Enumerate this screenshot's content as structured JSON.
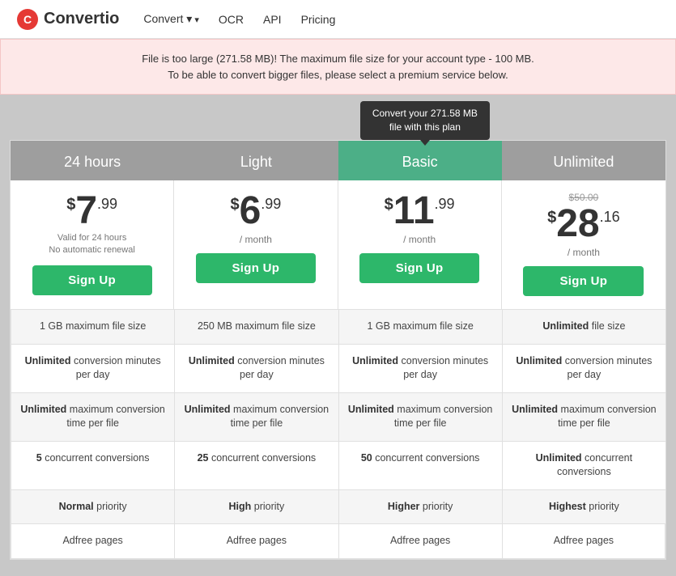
{
  "nav": {
    "logo_text": "Convertio",
    "links": [
      {
        "label": "Convert",
        "has_arrow": true
      },
      {
        "label": "OCR",
        "has_arrow": false
      },
      {
        "label": "API",
        "has_arrow": false
      },
      {
        "label": "Pricing",
        "has_arrow": false
      }
    ]
  },
  "alert": {
    "line1": "File is too large (271.58 MB)! The maximum file size for your account type - 100 MB.",
    "line2": "To be able to convert bigger files, please select a premium service below."
  },
  "tooltip": {
    "text": "Convert your 271.58 MB file with this plan"
  },
  "plans": [
    {
      "id": "24hours",
      "name": "24 hours",
      "header_class": "gray",
      "price_dollar": "$",
      "price_int": "7",
      "price_decimal": ".99",
      "price_period": "",
      "price_note": "Valid for 24 hours\nNo automatic renewal",
      "price_original": null,
      "signup_label": "Sign Up"
    },
    {
      "id": "light",
      "name": "Light",
      "header_class": "gray",
      "price_dollar": "$",
      "price_int": "6",
      "price_decimal": ".99",
      "price_period": "/ month",
      "price_note": null,
      "price_original": null,
      "signup_label": "Sign Up"
    },
    {
      "id": "basic",
      "name": "Basic",
      "header_class": "green-dark",
      "price_dollar": "$",
      "price_int": "11",
      "price_decimal": ".99",
      "price_period": "/ month",
      "price_note": null,
      "price_original": null,
      "signup_label": "Sign Up"
    },
    {
      "id": "unlimited",
      "name": "Unlimited",
      "header_class": "gray",
      "price_dollar": "$",
      "price_int": "28",
      "price_decimal": ".16",
      "price_period": "/ month",
      "price_note": null,
      "price_original": "$50.00",
      "signup_label": "Sign Up"
    }
  ],
  "features": [
    {
      "id": "file-size",
      "cells": [
        "1 GB maximum file size",
        "250 MB maximum file size",
        "1 GB maximum file size",
        "Unlimited file size"
      ],
      "bold_word": [
        "",
        "",
        "",
        "Unlimited"
      ]
    },
    {
      "id": "conv-minutes",
      "cells": [
        "Unlimited conversion minutes per day",
        "Unlimited conversion minutes per day",
        "Unlimited conversion minutes per day",
        "Unlimited conversion minutes per day"
      ],
      "bold_word": [
        "Unlimited",
        "Unlimited",
        "Unlimited",
        "Unlimited"
      ]
    },
    {
      "id": "conv-time",
      "cells": [
        "Unlimited maximum conversion time per file",
        "Unlimited maximum conversion time per file",
        "Unlimited maximum conversion time per file",
        "Unlimited maximum conversion time per file"
      ],
      "bold_word": [
        "Unlimited",
        "Unlimited",
        "Unlimited",
        "Unlimited"
      ]
    },
    {
      "id": "concurrent",
      "cells": [
        "5 concurrent conversions",
        "25 concurrent conversions",
        "50 concurrent conversions",
        "Unlimited concurrent conversions"
      ],
      "bold_word": [
        "5",
        "25",
        "50",
        "Unlimited"
      ]
    },
    {
      "id": "priority",
      "cells": [
        "Normal priority",
        "High priority",
        "Higher priority",
        "Highest priority"
      ],
      "bold_word": [
        "Normal",
        "High",
        "Higher",
        "Highest"
      ]
    },
    {
      "id": "adfree",
      "cells": [
        "Adfree pages",
        "Adfree pages",
        "Adfree pages",
        "Adfree pages"
      ],
      "bold_word": [
        "",
        "",
        "",
        ""
      ]
    }
  ]
}
